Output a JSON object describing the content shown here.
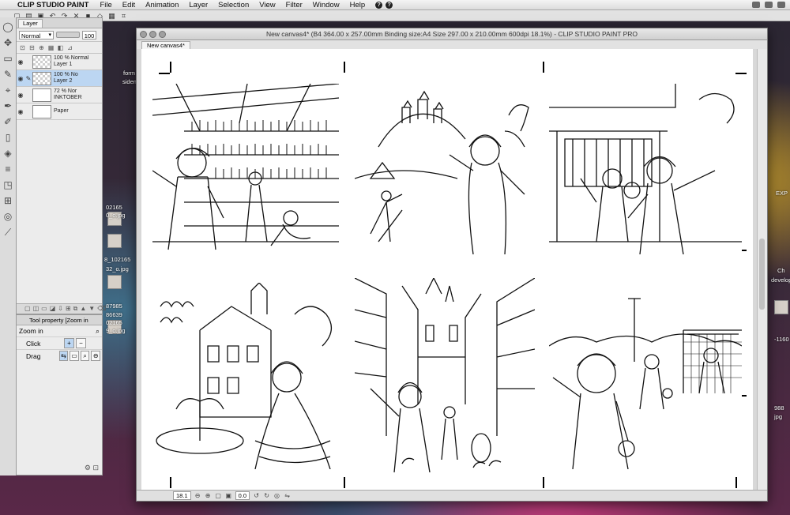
{
  "menubar": {
    "app_name": "CLIP STUDIO PAINT",
    "items": [
      "File",
      "Edit",
      "Animation",
      "Layer",
      "Selection",
      "View",
      "Filter",
      "Window",
      "Help"
    ],
    "help_buttons": [
      "?",
      "?"
    ]
  },
  "layer_panel": {
    "tab_label": "Layer",
    "blend_mode": "Normal",
    "opacity": "100",
    "layers": [
      {
        "line1": "100 % Normal",
        "line2": "Layer 1",
        "selected": false
      },
      {
        "line1": "100 % No",
        "line2": "Layer 2",
        "selected": true
      },
      {
        "line1": "72 % Nor",
        "line2": "INKTOBER",
        "selected": false
      },
      {
        "line1": "Paper",
        "line2": "",
        "selected": false
      }
    ]
  },
  "tool_property": {
    "header": "Tool property [Zoom in",
    "tool_name": "Zoom in",
    "properties": [
      {
        "label": "Click"
      },
      {
        "label": "Drag"
      }
    ]
  },
  "desktop": {
    "labels": [
      "form",
      "siden",
      "02165",
      "0_o.jpg",
      "8_102165",
      "32_o.jpg",
      "87985",
      "86639",
      "02165",
      "9_o.jpg",
      "EXP",
      "Ch",
      "develop",
      "-1160",
      "988",
      "jpg"
    ]
  },
  "canvas_window": {
    "title": "New canvas4* (B4 364.00 x 257.00mm Binding size:A4 Size 297.00 x 210.00mm 600dpi 18.1%) - CLIP STUDIO PAINT PRO",
    "tab_label": "New canvas4*",
    "zoom_value": "18.1",
    "angle_value": "0.0"
  },
  "panels": [
    {
      "name": "apothecary-scene",
      "description": "Two kids in a shop with shelves full of bottles"
    },
    {
      "name": "castle-farm-scene",
      "description": "Castle on a hill and a peasant girl in a field"
    },
    {
      "name": "school-kids-scene",
      "description": "Group of schoolchildren waving"
    },
    {
      "name": "mansion-garden-scene",
      "description": "Girl in a frilly dress near a fountain and mansion"
    },
    {
      "name": "medieval-street-scene",
      "description": "Boy in a crowded medieval street"
    },
    {
      "name": "soccer-scene",
      "description": "Boy playing soccer with a goalkeeper"
    }
  ]
}
